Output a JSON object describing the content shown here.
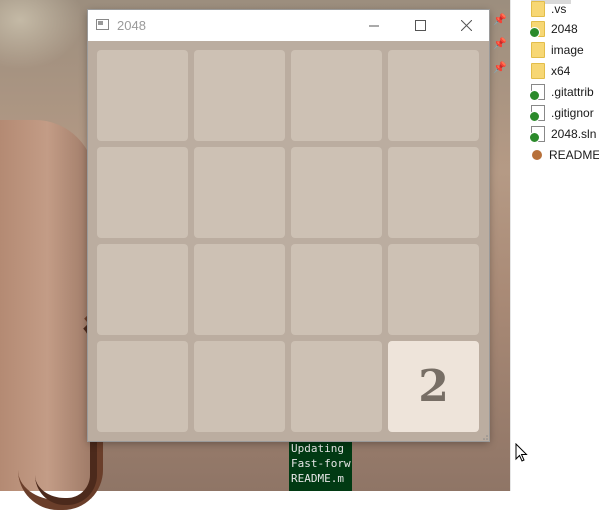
{
  "window": {
    "title": "2048",
    "icon": "app-window-icon",
    "controls": [
      "minimize-icon",
      "maximize-icon",
      "close-icon"
    ]
  },
  "game": {
    "background_color": "#bbada0",
    "empty_tile_color": "#cdc1b4",
    "tile_2_color": "#eee4da",
    "tile_text_color": "#776e65",
    "grid": [
      [
        "",
        "",
        "",
        ""
      ],
      [
        "",
        "",
        "",
        ""
      ],
      [
        "",
        "",
        "",
        ""
      ],
      [
        "",
        "",
        "",
        "2"
      ]
    ]
  },
  "file_panel": {
    "items": [
      {
        "label": ".vs",
        "icon": "folder-icon"
      },
      {
        "label": "2048",
        "icon": "folder-synced-icon"
      },
      {
        "label": "image",
        "icon": "folder-icon"
      },
      {
        "label": "x64",
        "icon": "folder-icon"
      },
      {
        "label": ".gitattrib",
        "icon": "file-synced-icon"
      },
      {
        "label": ".gitignor",
        "icon": "file-synced-icon"
      },
      {
        "label": "2048.sln",
        "icon": "solution-file-icon"
      },
      {
        "label": "README",
        "icon": "readme-icon"
      }
    ]
  },
  "console": {
    "lines": [
      "Updating",
      "Fast-forw",
      " README.m"
    ]
  }
}
